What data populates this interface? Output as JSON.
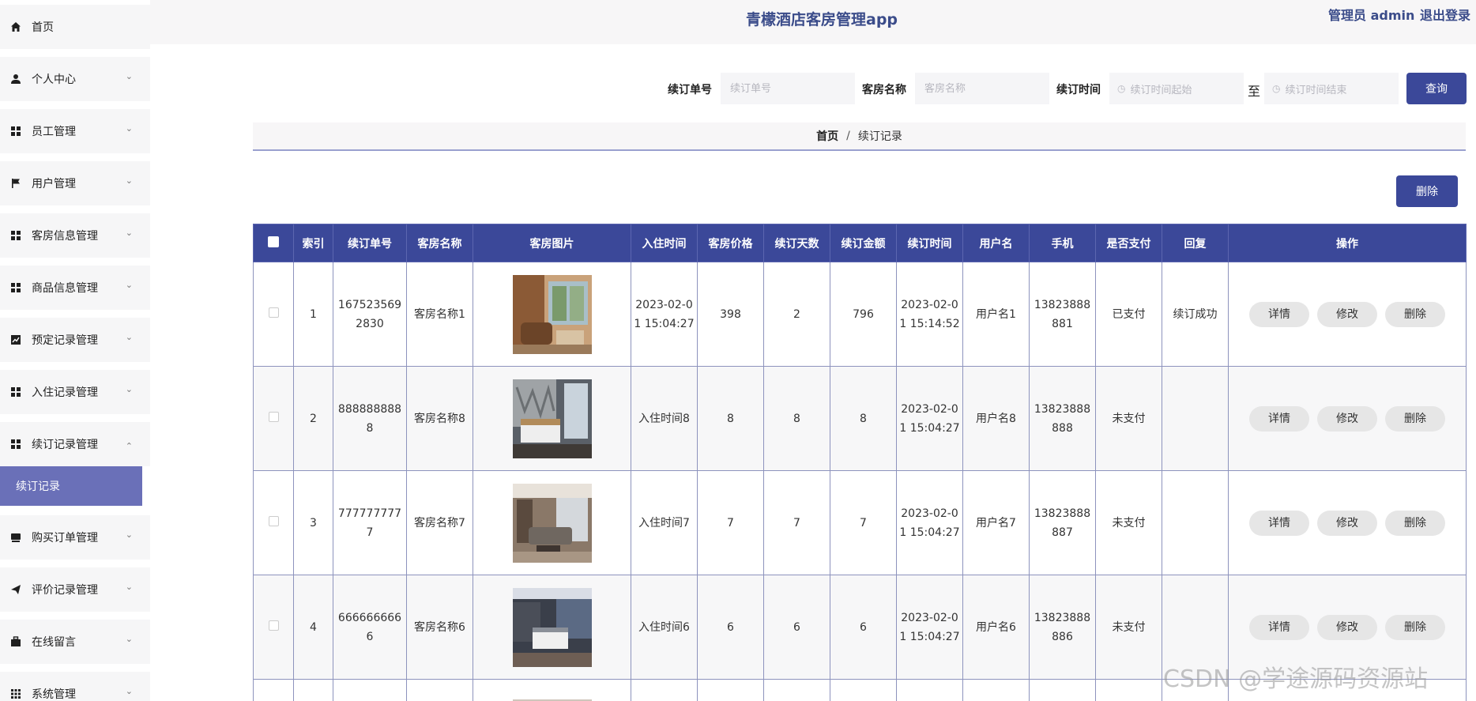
{
  "header": {
    "title": "青檬酒店客房管理app",
    "admin": "管理员 admin",
    "logout": "退出登录"
  },
  "sidebar": {
    "items": [
      {
        "label": "首页"
      },
      {
        "label": "个人中心"
      },
      {
        "label": "员工管理"
      },
      {
        "label": "用户管理"
      },
      {
        "label": "客房信息管理"
      },
      {
        "label": "商品信息管理"
      },
      {
        "label": "预定记录管理"
      },
      {
        "label": "入住记录管理"
      },
      {
        "label": "续订记录管理"
      },
      {
        "label": "购买订单管理"
      },
      {
        "label": "评价记录管理"
      },
      {
        "label": "在线留言"
      },
      {
        "label": "系统管理"
      }
    ],
    "active_sub": "续订记录"
  },
  "search": {
    "order_no_label": "续订单号",
    "order_no_placeholder": "续订单号",
    "room_name_label": "客房名称",
    "room_name_placeholder": "客房名称",
    "time_label": "续订时间",
    "time_start_placeholder": "续订时间起始",
    "to": "至",
    "time_end_placeholder": "续订时间结束",
    "query_button": "查询"
  },
  "breadcrumb": {
    "home": "首页",
    "separator": "/",
    "current": "续订记录"
  },
  "delete_button": "删除",
  "table": {
    "columns": [
      "索引",
      "续订单号",
      "客房名称",
      "客房图片",
      "入住时间",
      "客房价格",
      "续订天数",
      "续订金额",
      "续订时间",
      "用户名",
      "手机",
      "是否支付",
      "回复",
      "操作"
    ],
    "actions": [
      "详情",
      "修改",
      "删除"
    ],
    "rows": [
      {
        "index": "1",
        "order_no": "1675235692830",
        "room_name": "客房名称1",
        "checkin": "2023-02-01 15:04:27",
        "price": "398",
        "days": "2",
        "amount": "796",
        "time": "2023-02-01 15:14:52",
        "username": "用户名1",
        "phone": "13823888881",
        "paid": "已支付",
        "reply": "续订成功"
      },
      {
        "index": "2",
        "order_no": "8888888888",
        "room_name": "客房名称8",
        "checkin": "入住时间8",
        "price": "8",
        "days": "8",
        "amount": "8",
        "time": "2023-02-01 15:04:27",
        "username": "用户名8",
        "phone": "13823888888",
        "paid": "未支付",
        "reply": ""
      },
      {
        "index": "3",
        "order_no": "7777777777",
        "room_name": "客房名称7",
        "checkin": "入住时间7",
        "price": "7",
        "days": "7",
        "amount": "7",
        "time": "2023-02-01 15:04:27",
        "username": "用户名7",
        "phone": "13823888887",
        "paid": "未支付",
        "reply": ""
      },
      {
        "index": "4",
        "order_no": "6666666666",
        "room_name": "客房名称6",
        "checkin": "入住时间6",
        "price": "6",
        "days": "6",
        "amount": "6",
        "time": "2023-02-01 15:04:27",
        "username": "用户名6",
        "phone": "13823888886",
        "paid": "未支付",
        "reply": ""
      }
    ]
  },
  "watermark": "CSDN @学途源码资源站",
  "colors": {
    "primary": "#3b4899",
    "title": "#3b4c8a",
    "active_sub_bg": "#6a70b8"
  }
}
